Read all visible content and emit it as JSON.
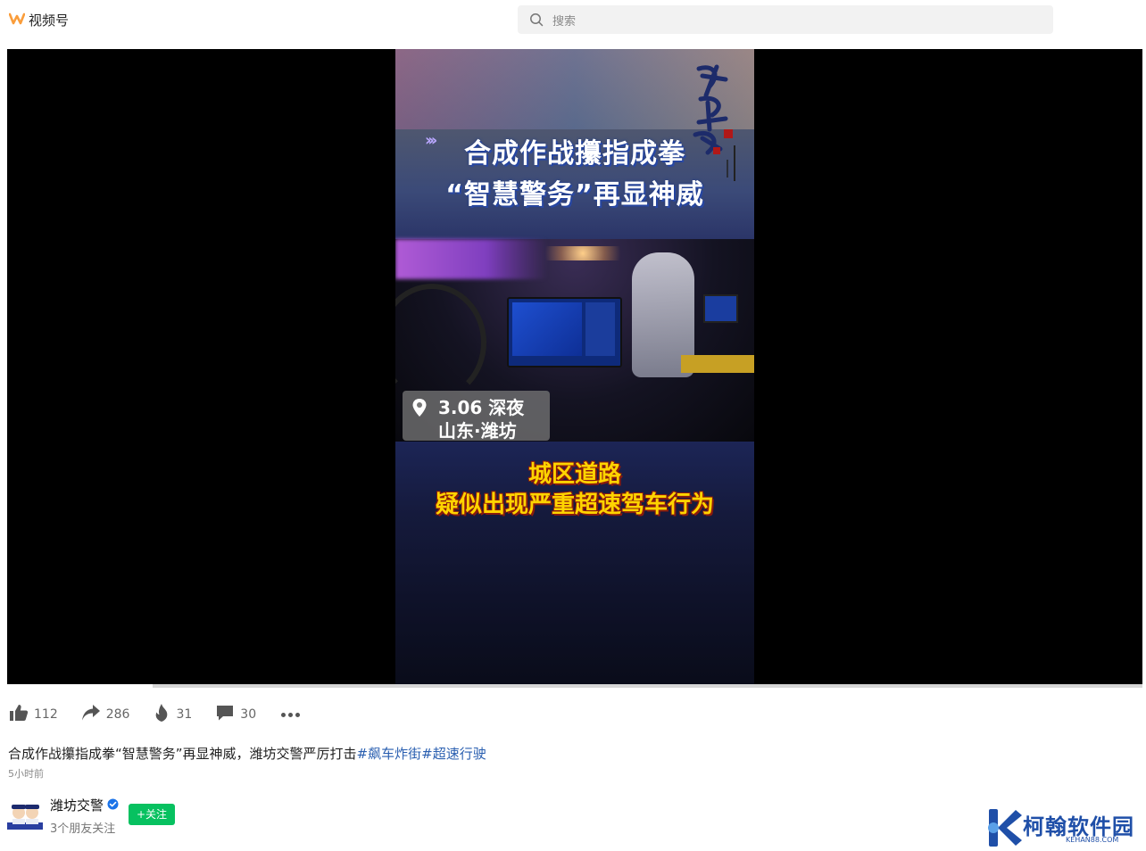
{
  "header": {
    "app_name": "视频号",
    "search_placeholder": "搜索"
  },
  "video": {
    "title_line1": "合成作战攥指成拳",
    "title_line2": "“智慧警务”再显神威",
    "location_date": "3.06 深夜",
    "location_place": "山东·潍坊",
    "caption_line1": "城区道路",
    "caption_line2": "疑似出现严重超速驾车行为",
    "progress": 0.128
  },
  "actions": {
    "likes": "112",
    "shares": "286",
    "hearts": "31",
    "comments": "30"
  },
  "post": {
    "description": "合成作战攥指成拳“智慧警务”再显神威，潍坊交警严厉打击",
    "tags": [
      "#飙车炸街",
      "#超速行驶"
    ],
    "time": "5小时前"
  },
  "author": {
    "name": "潍坊交警",
    "friends_following": "3个朋友关注",
    "follow_label": "+关注"
  },
  "watermark": {
    "name": "柯翰软件园",
    "url": "KEHAN88.COM"
  },
  "colors": {
    "accent": "#07c160",
    "tag": "#2a5fb0",
    "verified": "#1a73e8",
    "watermark": "#1f4fa8"
  }
}
